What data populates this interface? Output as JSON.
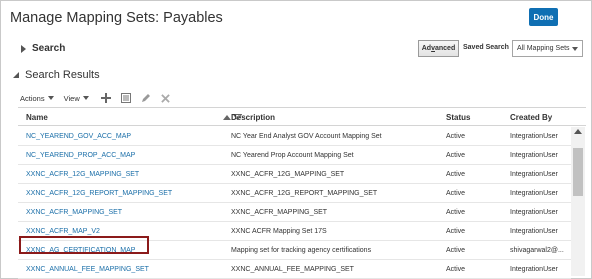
{
  "dialog": {
    "title": "Manage Mapping Sets: Payables",
    "done_label": "Done"
  },
  "search": {
    "label": "Search",
    "advanced_prefix": "Ad",
    "advanced_underlined": "v",
    "advanced_suffix": "anced",
    "saved_search_label": "Saved Search",
    "saved_search_value": "All Mapping Sets"
  },
  "results": {
    "label": "Search Results",
    "toolbar": {
      "actions_label": "Actions",
      "view_label": "View",
      "icons": [
        "add-icon",
        "view-details-icon",
        "edit-icon",
        "delete-icon"
      ]
    },
    "columns": {
      "name": "Name",
      "description": "Description",
      "status": "Status",
      "created_by": "Created By"
    },
    "rows": [
      {
        "name": "NC_YEAREND_GOV_ACC_MAP",
        "description": "NC Year End Analyst GOV Account Mapping Set",
        "status": "Active",
        "created_by": "IntegrationUser"
      },
      {
        "name": "NC_YEAREND_PROP_ACC_MAP",
        "description": "NC Yearend Prop Account Mapping Set",
        "status": "Active",
        "created_by": "IntegrationUser"
      },
      {
        "name": "XXNC_ACFR_12G_MAPPING_SET",
        "description": "XXNC_ACFR_12G_MAPPING_SET",
        "status": "Active",
        "created_by": "IntegrationUser"
      },
      {
        "name": "XXNC_ACFR_12G_REPORT_MAPPING_SET",
        "description": "XXNC_ACFR_12G_REPORT_MAPPING_SET",
        "status": "Active",
        "created_by": "IntegrationUser"
      },
      {
        "name": "XXNC_ACFR_MAPPING_SET",
        "description": "XXNC_ACFR_MAPPING_SET",
        "status": "Active",
        "created_by": "IntegrationUser"
      },
      {
        "name": "XXNC_ACFR_MAP_V2",
        "description": "XXNC ACFR Mapping Set 17S",
        "status": "Active",
        "created_by": "IntegrationUser"
      },
      {
        "name": "XXNC_AG_CERTIFICATION_MAP",
        "description": "Mapping set for tracking agency certifications",
        "status": "Active",
        "created_by": "shivagarwal2@..."
      },
      {
        "name": "XXNC_ANNUAL_FEE_MAPPING_SET",
        "description": "XXNC_ANNUAL_FEE_MAPPING_SET",
        "status": "Active",
        "created_by": "IntegrationUser"
      }
    ]
  },
  "colors": {
    "accent": "#0f6fb3",
    "link": "#1a6ea8",
    "highlight_border": "#8b1a1a"
  }
}
